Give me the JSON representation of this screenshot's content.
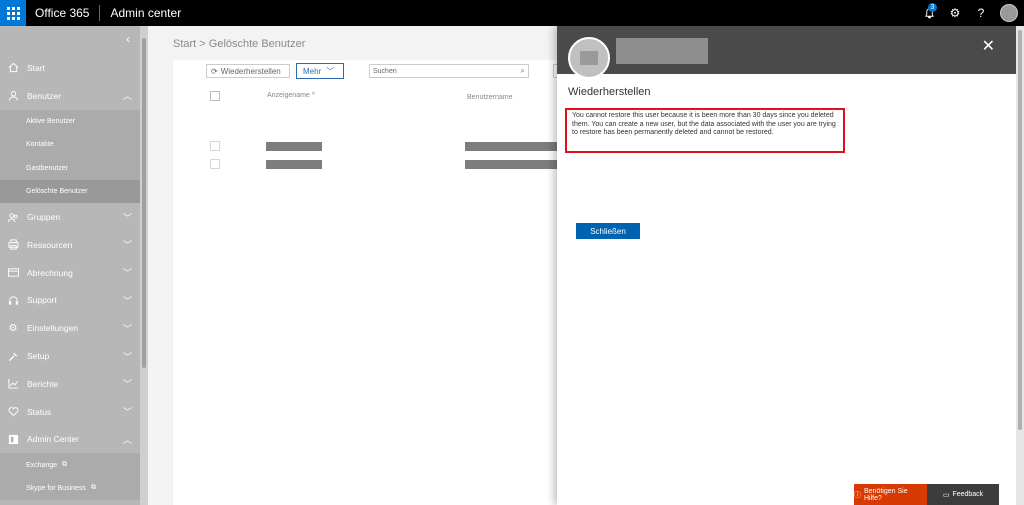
{
  "topbar": {
    "brand": "Office 365",
    "app": "Admin center",
    "notification_count": "3"
  },
  "icons": {
    "waffle": "waffle-icon",
    "bell": "bell-icon",
    "gear": "gear-icon",
    "help": "question-icon"
  },
  "sidebar": {
    "items": [
      {
        "label": "Start",
        "icon": "home-icon"
      },
      {
        "label": "Benutzer",
        "icon": "user-icon",
        "expanded": true,
        "children": [
          "Aktive Benutzer",
          "Kontakte",
          "Gastbenutzer",
          "Gelöschte Benutzer"
        ]
      },
      {
        "label": "Gruppen",
        "icon": "group-icon"
      },
      {
        "label": "Ressourcen",
        "icon": "printer-icon"
      },
      {
        "label": "Abrechnung",
        "icon": "credit-card-icon"
      },
      {
        "label": "Support",
        "icon": "headset-icon"
      },
      {
        "label": "Einstellungen",
        "icon": "gear-icon"
      },
      {
        "label": "Setup",
        "icon": "wrench-icon"
      },
      {
        "label": "Berichte",
        "icon": "chart-icon"
      },
      {
        "label": "Status",
        "icon": "heart-icon"
      },
      {
        "label": "Admin Center",
        "icon": "admin-icon",
        "expanded": true,
        "children": [
          "Exchange",
          "Skype for Business"
        ]
      }
    ]
  },
  "main": {
    "breadcrumb": "Start > Gelöschte Benutzer",
    "restore_button": "Wiederherstellen",
    "more_button": "Mehr",
    "search_placeholder": "Suchen",
    "col_display_name": "Anzeigename",
    "col_username": "Benutzername"
  },
  "panel": {
    "title": "Wiederherstellen",
    "message": "You cannot restore this user because it is been more than 30 days since you deleted them. You can create a new user, but the data associated with the user you are trying to restore has been permanently deleted and cannot be restored.",
    "close_button": "Schließen"
  },
  "footer": {
    "help": "Benötigen Sie Hilfe?",
    "feedback": "Feedback"
  }
}
